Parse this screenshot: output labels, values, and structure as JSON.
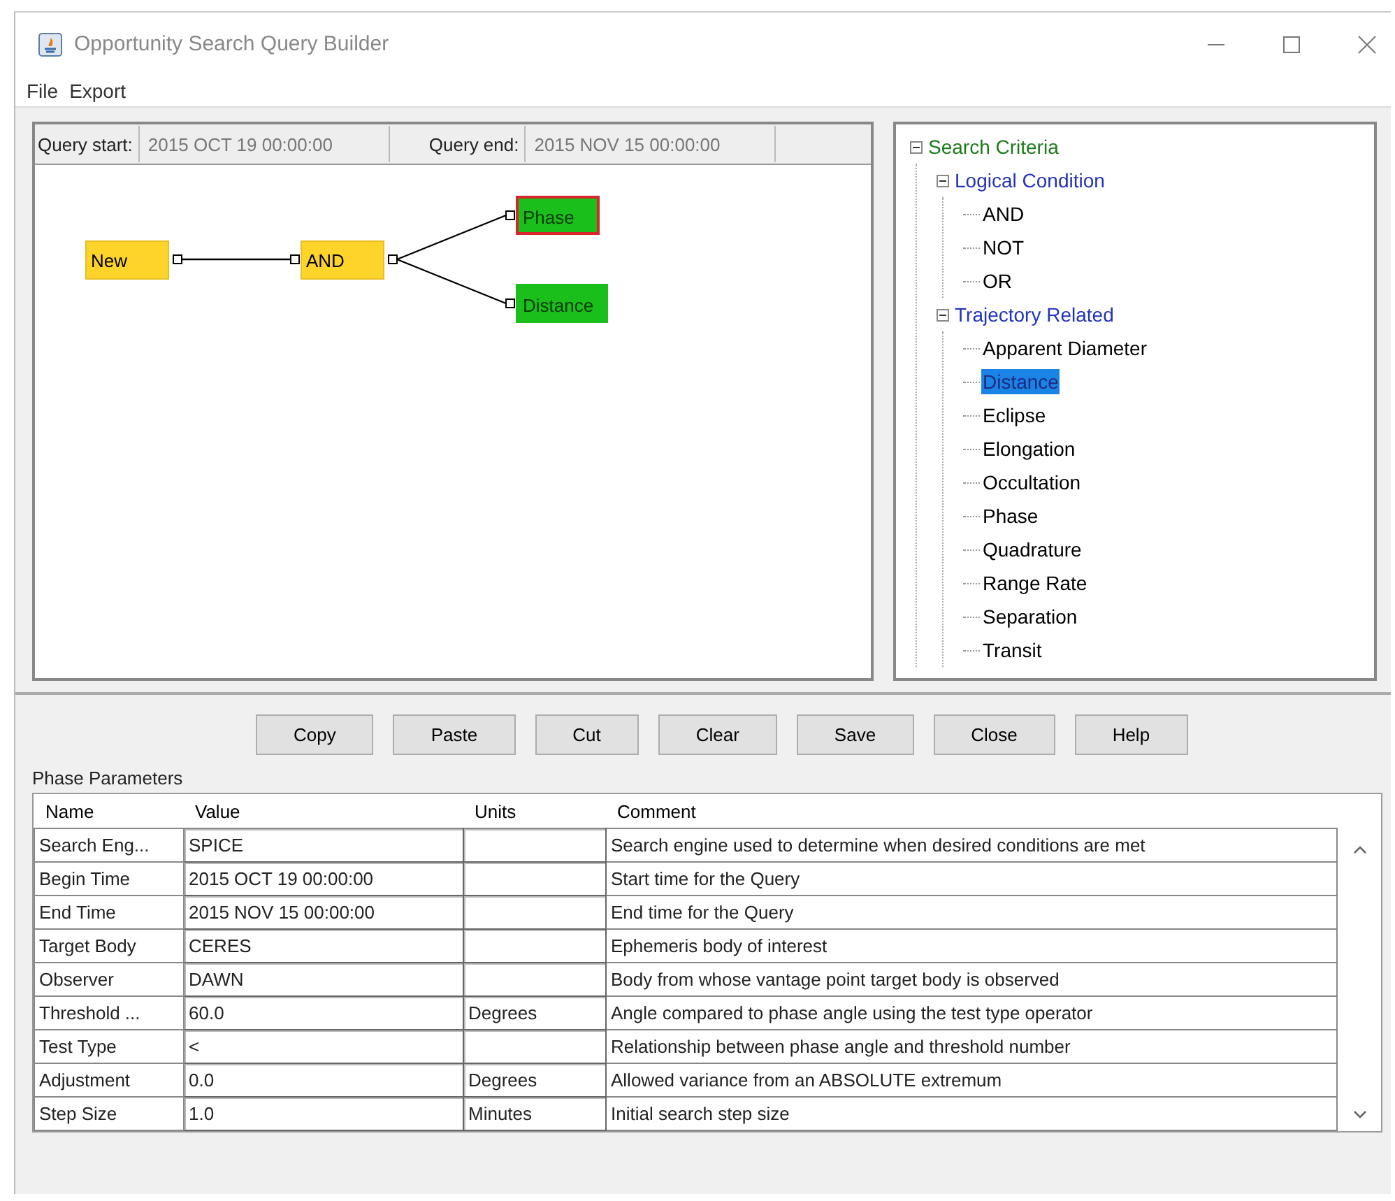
{
  "window": {
    "title": "Opportunity Search Query Builder"
  },
  "menu": [
    "File",
    "Export"
  ],
  "query": {
    "start_label": "Query start:",
    "start": "2015 OCT 19 00:00:00",
    "end_label": "Query end:",
    "end": "2015 NOV 15 00:00:00"
  },
  "diagram": {
    "label": "New",
    "kind": "logic",
    "selected": false,
    "children": [
      {
        "label": "AND",
        "kind": "logic",
        "selected": false,
        "children": [
          {
            "label": "Phase",
            "kind": "criterion",
            "selected": true
          },
          {
            "label": "Distance",
            "kind": "criterion",
            "selected": false
          }
        ]
      }
    ]
  },
  "tree": {
    "label": "Search Criteria",
    "kind": "root",
    "expanded": true,
    "selected": false,
    "children": [
      {
        "label": "Logical Condition",
        "kind": "category",
        "expanded": true,
        "selected": false,
        "children": [
          {
            "label": "AND",
            "kind": "leaf",
            "selected": false
          },
          {
            "label": "NOT",
            "kind": "leaf",
            "selected": false
          },
          {
            "label": "OR",
            "kind": "leaf",
            "selected": false
          }
        ]
      },
      {
        "label": "Trajectory Related",
        "kind": "category",
        "expanded": true,
        "selected": false,
        "children": [
          {
            "label": "Apparent Diameter",
            "kind": "leaf",
            "selected": false
          },
          {
            "label": "Distance",
            "kind": "leaf",
            "selected": true
          },
          {
            "label": "Eclipse",
            "kind": "leaf",
            "selected": false
          },
          {
            "label": "Elongation",
            "kind": "leaf",
            "selected": false
          },
          {
            "label": "Occultation",
            "kind": "leaf",
            "selected": false
          },
          {
            "label": "Phase",
            "kind": "leaf",
            "selected": false
          },
          {
            "label": "Quadrature",
            "kind": "leaf",
            "selected": false
          },
          {
            "label": "Range Rate",
            "kind": "leaf",
            "selected": false
          },
          {
            "label": "Separation",
            "kind": "leaf",
            "selected": false
          },
          {
            "label": "Transit",
            "kind": "leaf",
            "selected": false
          }
        ]
      }
    ]
  },
  "buttons": [
    "Copy",
    "Paste",
    "Cut",
    "Clear",
    "Save",
    "Close",
    "Help"
  ],
  "parameters": {
    "title": "Phase Parameters",
    "columns": [
      "Name",
      "Value",
      "Units",
      "Comment"
    ],
    "rows": [
      [
        "Search Eng...",
        "SPICE",
        "",
        "Search engine used to determine when desired conditions are met"
      ],
      [
        "Begin Time",
        "2015 OCT 19 00:00:00",
        "",
        "Start time for the Query"
      ],
      [
        "End Time",
        "2015 NOV 15 00:00:00",
        "",
        "End time for the Query"
      ],
      [
        "Target Body",
        "CERES",
        "",
        "Ephemeris body of interest"
      ],
      [
        "Observer",
        "DAWN",
        "",
        "Body from whose vantage point target body is observed"
      ],
      [
        "Threshold ...",
        "60.0",
        "Degrees",
        "Angle compared to phase angle using the test type operator"
      ],
      [
        "Test Type",
        "<",
        "",
        "Relationship between phase angle and threshold number"
      ],
      [
        "Adjustment",
        "0.0",
        "Degrees",
        "Allowed variance from an ABSOLUTE extremum"
      ],
      [
        "Step Size",
        "1.0",
        "Minutes",
        "Initial search step size"
      ]
    ]
  }
}
